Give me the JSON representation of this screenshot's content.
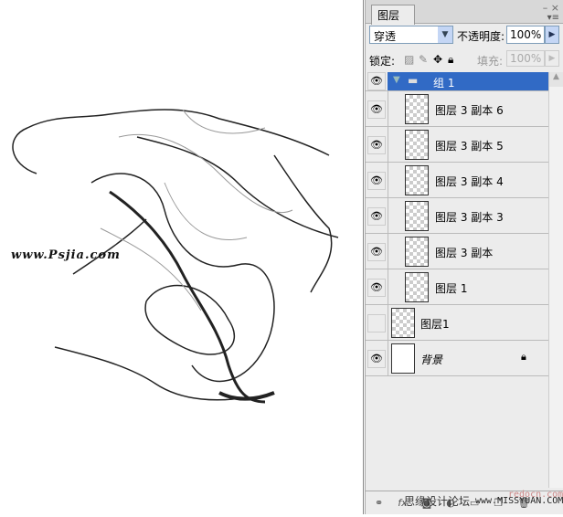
{
  "canvas": {
    "watermark": "www.Psjia.com"
  },
  "panel": {
    "tab": "图层",
    "close": "×",
    "window_controls": "– ×",
    "menu_icon": "▾≡",
    "blend_mode": "穿透",
    "opacity_label": "不透明度:",
    "opacity": "100%",
    "lock_label": "锁定:",
    "fill_label": "填充:",
    "fill": "100%",
    "group": {
      "name": "组 1",
      "expanded": true,
      "visible": true,
      "selected": true
    },
    "layers": [
      {
        "name": "图层 3 副本 6",
        "visible": true,
        "in_group": true
      },
      {
        "name": "图层 3 副本 5",
        "visible": true,
        "in_group": true
      },
      {
        "name": "图层 3 副本 4",
        "visible": true,
        "in_group": true
      },
      {
        "name": "图层 3 副本 3",
        "visible": true,
        "in_group": true
      },
      {
        "name": "图层 3 副本",
        "visible": true,
        "in_group": true
      },
      {
        "name": "图层 1",
        "visible": true,
        "in_group": true
      },
      {
        "name": "图层1",
        "visible": false,
        "in_group": false
      },
      {
        "name": "背景",
        "visible": true,
        "in_group": false,
        "locked": true
      }
    ],
    "bottom_icons": [
      "link-icon",
      "fx-icon",
      "mask-icon",
      "adjustment-icon",
      "folder-icon",
      "new-layer-icon",
      "trash-icon"
    ]
  },
  "watermarks": {
    "forum": "思缘设计论坛",
    "site": "www.MISSYUAN.COM",
    "redocn": "redocn.com"
  }
}
